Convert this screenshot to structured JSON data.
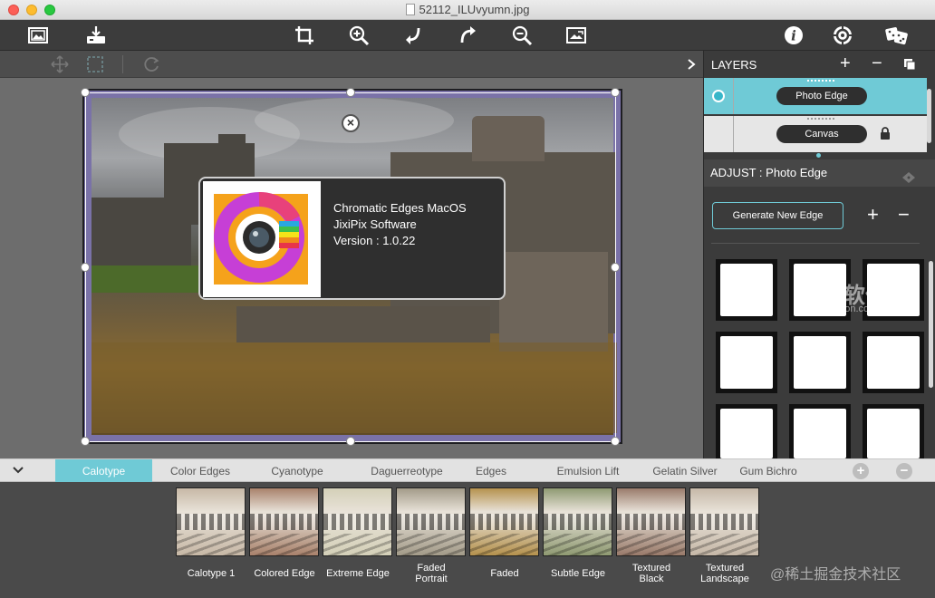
{
  "window": {
    "title": "52112_ILUvyumn.jpg"
  },
  "toolbar": {
    "left_icons": [
      "image-open-icon",
      "download-tray-icon"
    ],
    "center_icons": [
      "crop-icon",
      "zoom-in-icon",
      "undo-icon",
      "redo-icon",
      "zoom-out-icon",
      "fit-image-icon"
    ],
    "right_icons": [
      "info-icon",
      "settings-icon",
      "dice-icon"
    ]
  },
  "about": {
    "app_name": "Chromatic Edges MacOS",
    "company": "JixiPix Software",
    "version": "Version : 1.0.22"
  },
  "layers": {
    "header": "LAYERS",
    "add": "+",
    "remove": "−",
    "items": [
      {
        "label": "Photo Edge",
        "active": true
      },
      {
        "label": "Canvas",
        "active": false,
        "locked": true
      }
    ]
  },
  "adjust": {
    "header": "ADJUST : Photo Edge",
    "generate_button": "Generate New Edge",
    "add": "+",
    "remove": "−"
  },
  "tabs": {
    "items": [
      "Calotype",
      "Color Edges",
      "Cyanotype",
      "Daguerreotype",
      "Edges",
      "Emulsion Lift",
      "Gelatin Silver",
      "Gum Bichro"
    ],
    "active_index": 0,
    "add": "+",
    "remove": "−"
  },
  "thumbnails": [
    {
      "label": "Calotype 1",
      "tint": "#c7b8a6"
    },
    {
      "label": "Colored Edge",
      "tint": "#a9826c"
    },
    {
      "label": "Extreme Edge",
      "tint": "#d4d0b8"
    },
    {
      "label": "Faded\nPortrait",
      "tint": "#a39b89"
    },
    {
      "label": "Faded",
      "tint": "#b5924e"
    },
    {
      "label": "Subtle Edge",
      "tint": "#8f9a72"
    },
    {
      "label": "Textured\nBlack",
      "tint": "#9a7b6b"
    },
    {
      "label": "Textured\nLandscape",
      "tint": "#c6b8a8"
    }
  ],
  "watermarks": {
    "top_right_cn": "未来软件园",
    "top_right_url": "mac.orsoon.com",
    "bottom_right": "@稀土掘金技术社区"
  },
  "colors": {
    "accent": "#6fcad6",
    "panel_bg": "#3b3b3b",
    "toolbar_bg": "#3c3c3c"
  }
}
